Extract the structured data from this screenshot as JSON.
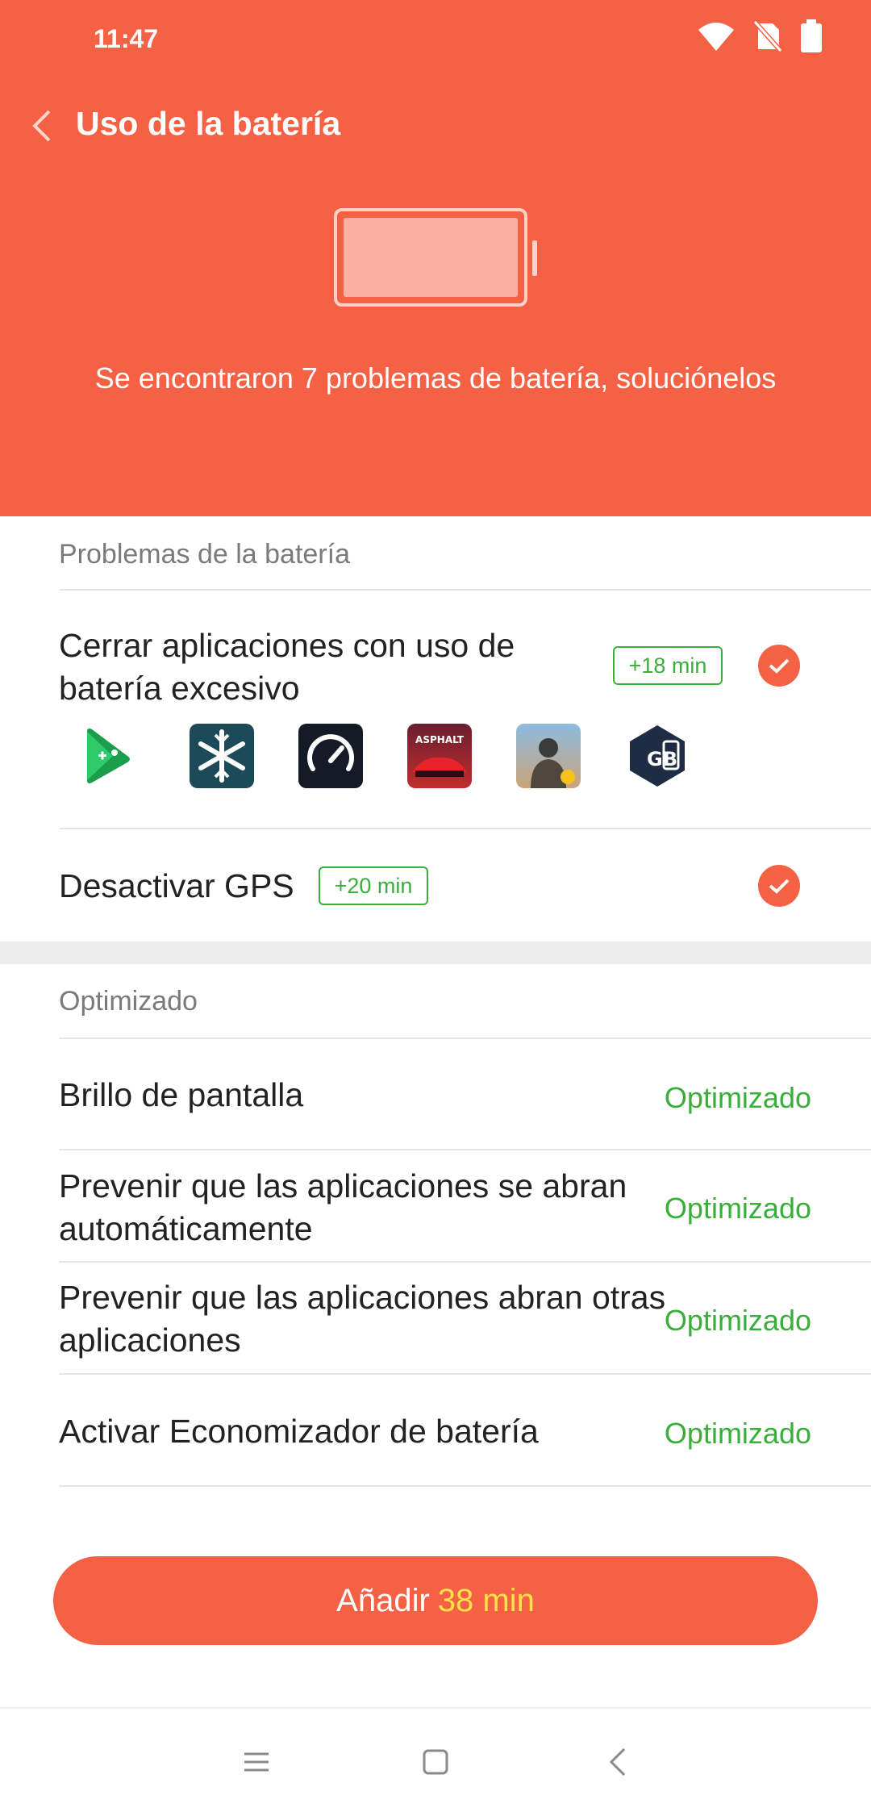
{
  "status_bar": {
    "time": "11:47"
  },
  "header": {
    "title": "Uso de la batería",
    "message": "Se encontraron 7 problemas de batería, soluciónelos"
  },
  "issues_section": {
    "label": "Problemas de la batería",
    "items": [
      {
        "title": "Cerrar aplicaciones con uso de batería excesivo",
        "badge": "+18 min",
        "checked": true
      },
      {
        "title": "Desactivar GPS",
        "badge": "+20 min",
        "checked": true
      }
    ],
    "app_icons": [
      "google-play-games-icon",
      "snowflake-app-icon",
      "speedtest-icon",
      "asphalt-9-icon",
      "pubg-mobile-icon",
      "gb-phone-icon"
    ]
  },
  "optimized_section": {
    "label": "Optimizado",
    "items": [
      {
        "title": "Brillo de pantalla",
        "status": "Optimizado"
      },
      {
        "title": "Prevenir que las aplicaciones se abran automáticamente",
        "status": "Optimizado"
      },
      {
        "title": "Prevenir que las aplicaciones abran otras aplicaciones",
        "status": "Optimizado"
      },
      {
        "title": "Activar Economizador de batería",
        "status": "Optimizado"
      }
    ]
  },
  "action_button": {
    "prefix": "Añadir",
    "amount": "38 min"
  },
  "colors": {
    "accent": "#f56145",
    "success": "#3aae3a",
    "highlight": "#ffe14a"
  }
}
